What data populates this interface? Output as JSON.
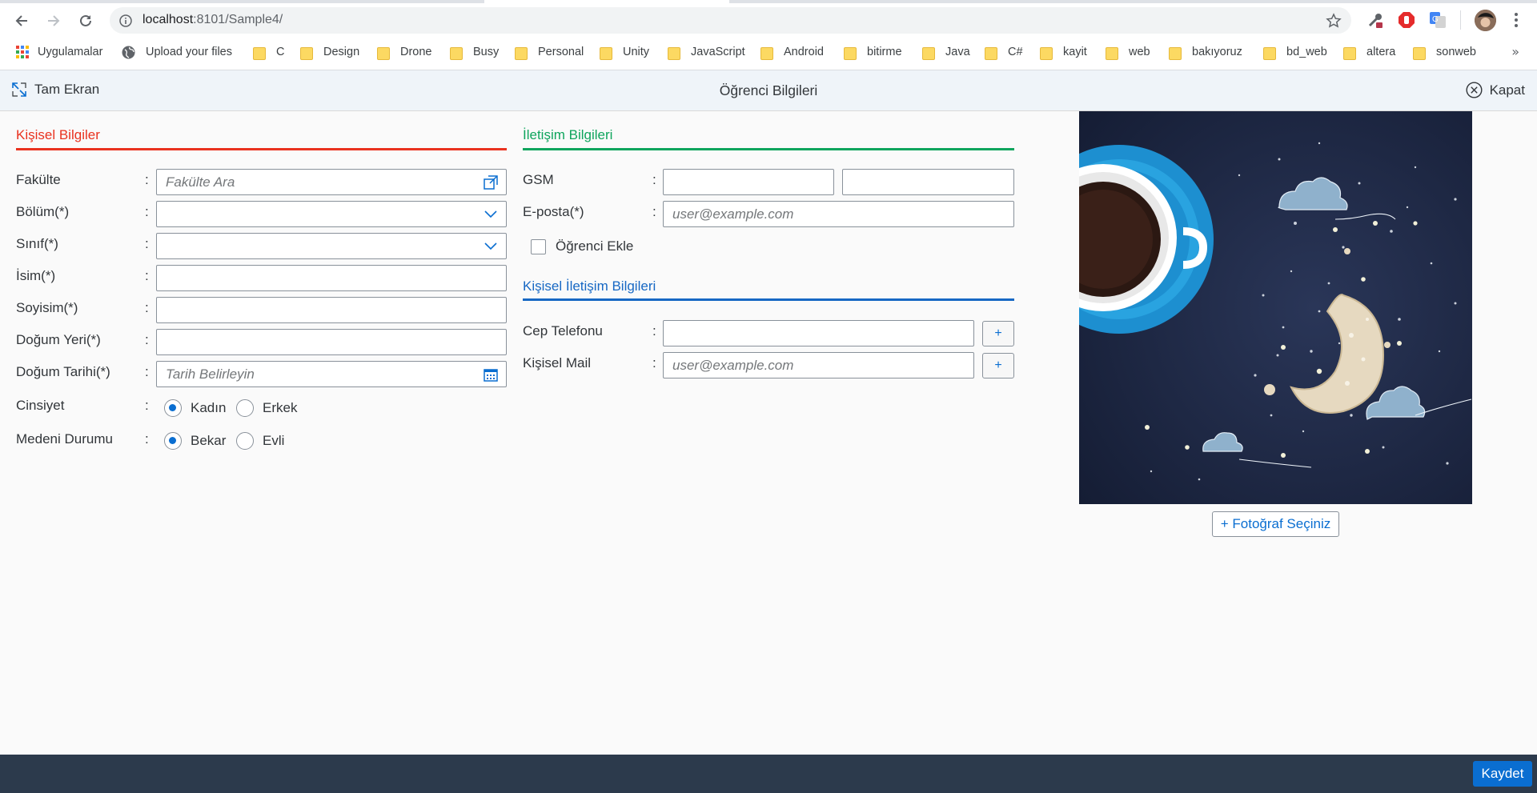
{
  "browser": {
    "url_host": "localhost",
    "url_rest": ":8101/Sample4/",
    "bookmarks": [
      {
        "label": "Uygulamalar",
        "icon": "apps-grid-icon"
      },
      {
        "label": "Upload your files",
        "icon": "globe-icon"
      },
      {
        "label": "C",
        "icon": "folder-icon"
      },
      {
        "label": "Design",
        "icon": "folder-icon"
      },
      {
        "label": "Drone",
        "icon": "folder-icon"
      },
      {
        "label": "Busy",
        "icon": "folder-icon"
      },
      {
        "label": "Personal",
        "icon": "folder-icon"
      },
      {
        "label": "Unity",
        "icon": "folder-icon"
      },
      {
        "label": "JavaScript",
        "icon": "folder-icon"
      },
      {
        "label": "Android",
        "icon": "folder-icon"
      },
      {
        "label": "bitirme",
        "icon": "folder-icon"
      },
      {
        "label": "Java",
        "icon": "folder-icon"
      },
      {
        "label": "C#",
        "icon": "folder-icon"
      },
      {
        "label": "kayit",
        "icon": "folder-icon"
      },
      {
        "label": "web",
        "icon": "folder-icon"
      },
      {
        "label": "bakıyoruz",
        "icon": "folder-icon"
      },
      {
        "label": "bd_web",
        "icon": "folder-icon"
      },
      {
        "label": "altera",
        "icon": "folder-icon"
      },
      {
        "label": "sonweb",
        "icon": "folder-icon"
      }
    ],
    "bookmarks_more": "»"
  },
  "appbar": {
    "fullscreen_label": "Tam Ekran",
    "title": "Öğrenci Bilgileri",
    "close_label": "Kapat"
  },
  "personal": {
    "title": "Kişisel Bilgiler",
    "faculty_label": "Fakülte",
    "faculty_placeholder": "Fakülte Ara",
    "department_label": "Bölüm(*)",
    "class_label": "Sınıf(*)",
    "name_label": "İsim(*)",
    "surname_label": "Soyisim(*)",
    "birthplace_label": "Doğum Yeri(*)",
    "birthdate_label": "Doğum Tarihi(*)",
    "birthdate_placeholder": "Tarih Belirleyin",
    "gender_label": "Cinsiyet",
    "gender_options": [
      "Kadın",
      "Erkek"
    ],
    "gender_selected": "Kadın",
    "marital_label": "Medeni Durumu",
    "marital_options": [
      "Bekar",
      "Evli"
    ],
    "marital_selected": "Bekar",
    "colon": ":"
  },
  "contact": {
    "title": "İletişim Bilgileri",
    "gsm_label": "GSM",
    "email_label": "E-posta(*)",
    "email_placeholder": "user@example.com",
    "add_student_label": "Öğrenci Ekle"
  },
  "personal_contact": {
    "title": "Kişisel İletişim Bilgileri",
    "mobile_label": "Cep Telefonu",
    "mail_label": "Kişisel Mail",
    "mail_placeholder": "user@example.com",
    "plus": "+"
  },
  "photo": {
    "select_label": "+ Fotoğraf Seçiniz"
  },
  "footer": {
    "save_label": "Kaydet"
  },
  "colors": {
    "personal_accent": "#e9321f",
    "contact_accent": "#0fa55d",
    "personal_contact_accent": "#1768c4",
    "primary": "#0a6ed1",
    "footer_bg": "#2c3a4c"
  }
}
